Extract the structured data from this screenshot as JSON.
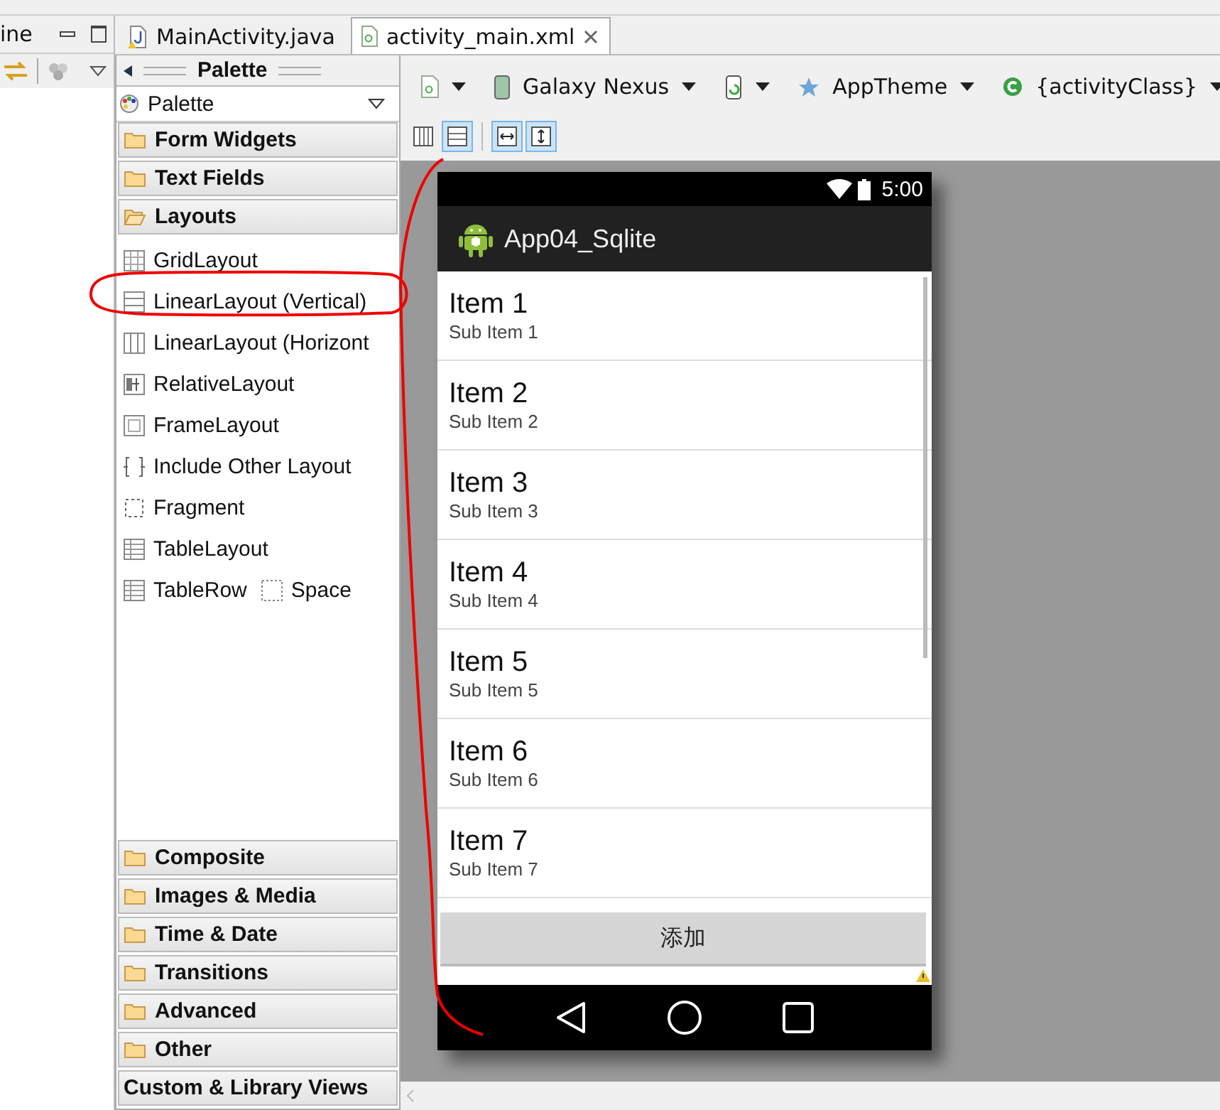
{
  "outline_panel": {
    "title": "ine"
  },
  "editor_tabs": [
    {
      "label": "MainActivity.java",
      "kind": "java",
      "selected": false
    },
    {
      "label": "activity_main.xml",
      "kind": "xml",
      "selected": true
    }
  ],
  "palette": {
    "title": "Palette",
    "dropdown": "Palette",
    "categories_top": [
      {
        "label": "Form Widgets",
        "kind": "folder",
        "expanded": false
      },
      {
        "label": "Text Fields",
        "kind": "folder",
        "expanded": false
      },
      {
        "label": "Layouts",
        "kind": "folder",
        "expanded": true
      }
    ],
    "rows": [
      {
        "items": [
          {
            "label": "GridLayout",
            "kind": "grid"
          }
        ]
      },
      {
        "items": [
          {
            "label": "LinearLayout (Vertical)",
            "kind": "linear-v"
          }
        ]
      },
      {
        "items": [
          {
            "label": "LinearLayout (Horizont",
            "kind": "linear-h"
          }
        ]
      },
      {
        "items": [
          {
            "label": "RelativeLayout",
            "kind": "relative"
          }
        ]
      },
      {
        "items": [
          {
            "label": "FrameLayout",
            "kind": "frame"
          }
        ]
      },
      {
        "items": [
          {
            "label": "Include Other Layout",
            "kind": "include"
          }
        ]
      },
      {
        "items": [
          {
            "label": "Fragment",
            "kind": "fragment"
          }
        ]
      },
      {
        "items": [
          {
            "label": "TableLayout",
            "kind": "table"
          }
        ]
      },
      {
        "items": [
          {
            "label": "TableRow",
            "kind": "table"
          },
          {
            "label": "Space",
            "kind": "space"
          }
        ]
      }
    ],
    "categories_bottom": [
      {
        "label": "Composite",
        "kind": "folder",
        "expanded": false
      },
      {
        "label": "Images & Media",
        "kind": "folder",
        "expanded": false
      },
      {
        "label": "Time & Date",
        "kind": "folder",
        "expanded": false
      },
      {
        "label": "Transitions",
        "kind": "folder",
        "expanded": false
      },
      {
        "label": "Advanced",
        "kind": "folder",
        "expanded": false
      },
      {
        "label": "Other",
        "kind": "folder",
        "expanded": false
      },
      {
        "label": "Custom & Library Views",
        "kind": "plain"
      }
    ]
  },
  "toolbar": [
    {
      "kind": "layout-file"
    },
    {
      "kind": "device",
      "label": "Galaxy Nexus"
    },
    {
      "kind": "orientation"
    },
    {
      "kind": "theme",
      "label": "AppTheme"
    },
    {
      "kind": "activity",
      "label": "{activityClass}"
    }
  ],
  "view_toggles": [
    {
      "kind": "columns",
      "selected": false
    },
    {
      "kind": "rows",
      "selected": true
    },
    {
      "kind": "fit-width",
      "selected": true
    },
    {
      "kind": "fit-height",
      "selected": true
    }
  ],
  "phone": {
    "time": "5:00",
    "app_title": "App04_Sqlite",
    "list": [
      {
        "title": "Item 1",
        "subtitle": "Sub Item 1"
      },
      {
        "title": "Item 2",
        "subtitle": "Sub Item 2"
      },
      {
        "title": "Item 3",
        "subtitle": "Sub Item 3"
      },
      {
        "title": "Item 4",
        "subtitle": "Sub Item 4"
      },
      {
        "title": "Item 5",
        "subtitle": "Sub Item 5"
      },
      {
        "title": "Item 6",
        "subtitle": "Sub Item 6"
      },
      {
        "title": "Item 7",
        "subtitle": "Sub Item 7"
      }
    ],
    "button": "添加",
    "warning": true
  }
}
